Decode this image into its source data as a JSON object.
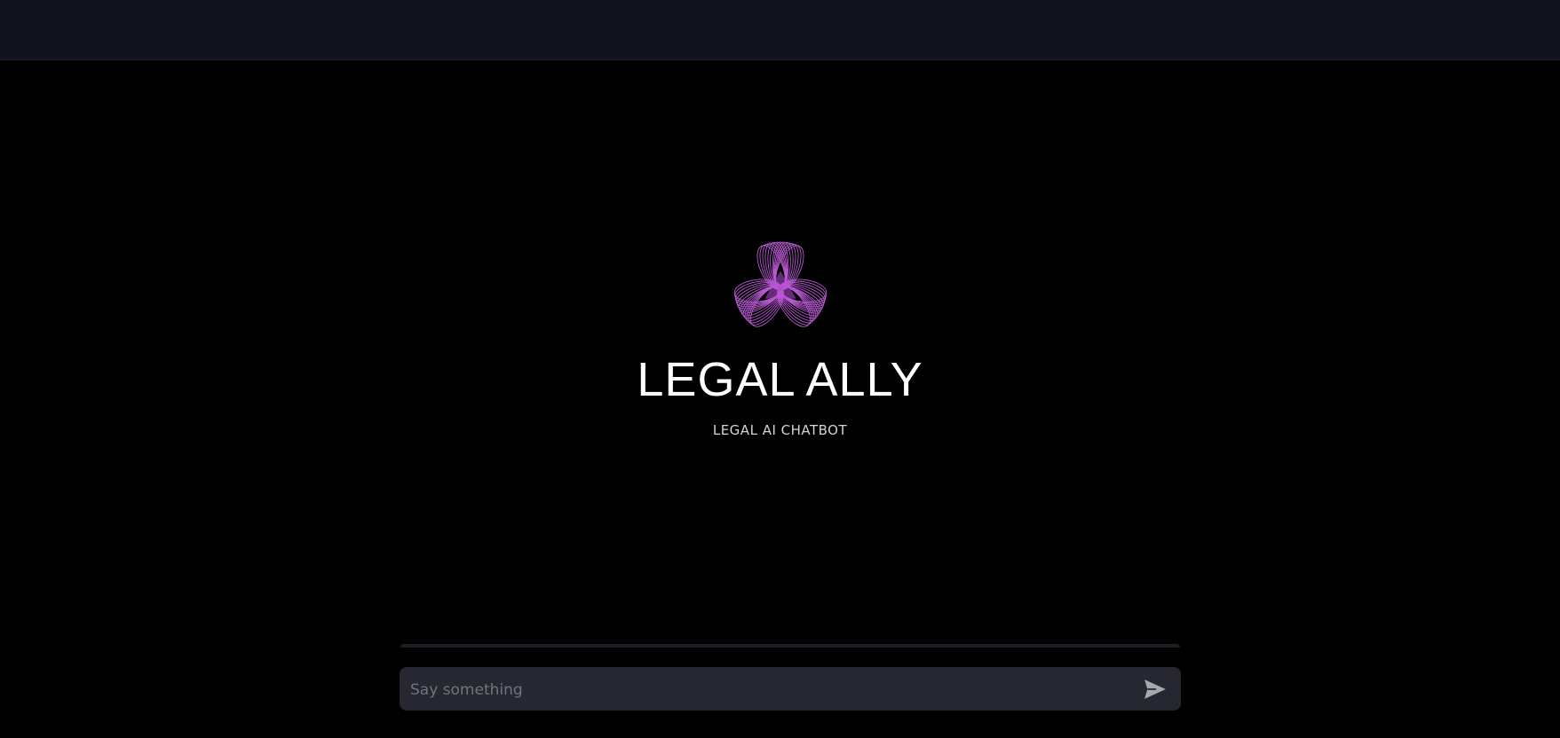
{
  "app": {
    "title": "LEGAL ALLY",
    "subtitle": "LEGAL AI CHATBOT"
  },
  "chat": {
    "input_placeholder": "Say something",
    "input_value": ""
  },
  "icons": {
    "logo": "flower-logo-icon",
    "send": "send-icon"
  },
  "colors": {
    "background": "#000000",
    "topbar": "#11141e",
    "input_background": "#262730",
    "logo_accent": "#c45fe0",
    "title_text": "#ffffff",
    "subtitle_text": "#d2d4d9",
    "placeholder_text": "#72747d",
    "send_icon": "#a6a8b0"
  }
}
